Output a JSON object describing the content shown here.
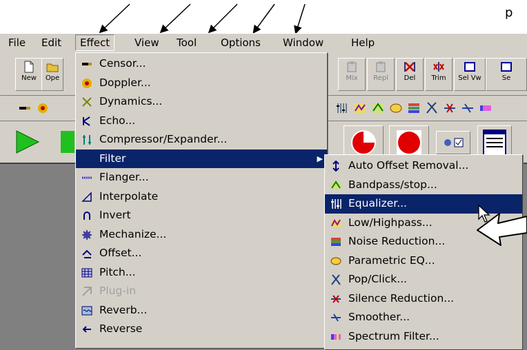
{
  "annotation": {
    "callout_text": "p"
  },
  "menubar": {
    "items": [
      "File",
      "Edit",
      "Effect",
      "View",
      "Tool",
      "Options",
      "Window",
      "Help"
    ]
  },
  "toolbar": {
    "left_buttons": [
      {
        "label": "New",
        "icon": "new-file-icon"
      },
      {
        "label": "Ope",
        "icon": "open-folder-icon"
      }
    ],
    "right_buttons": [
      {
        "label": "Mix",
        "icon": "mix-icon"
      },
      {
        "label": "Repl",
        "icon": "replace-icon"
      },
      {
        "label": "Del",
        "icon": "delete-icon"
      },
      {
        "label": "Trim",
        "icon": "trim-icon"
      },
      {
        "label": "Sel Vw",
        "icon": "select-view-icon"
      },
      {
        "label": "Se",
        "icon": "select-icon"
      }
    ]
  },
  "effect_menu": {
    "items": [
      {
        "label": "Censor...",
        "icon": "censor-icon"
      },
      {
        "label": "Doppler...",
        "icon": "doppler-icon"
      },
      {
        "label": "Dynamics...",
        "icon": "dynamics-icon"
      },
      {
        "label": "Echo...",
        "icon": "echo-icon"
      },
      {
        "label": "Compressor/Expander...",
        "icon": "compressor-icon"
      },
      {
        "label": "Filter",
        "icon": "",
        "submenu": "▶"
      },
      {
        "label": "Flanger...",
        "icon": "flanger-icon"
      },
      {
        "label": "Interpolate",
        "icon": "interpolate-icon"
      },
      {
        "label": "Invert",
        "icon": "invert-icon"
      },
      {
        "label": "Mechanize...",
        "icon": "mechanize-icon"
      },
      {
        "label": "Offset...",
        "icon": "offset-icon"
      },
      {
        "label": "Pitch...",
        "icon": "pitch-icon"
      },
      {
        "label": "Plug-in",
        "icon": "plugin-icon"
      },
      {
        "label": "Reverb...",
        "icon": "reverb-icon"
      },
      {
        "label": "Reverse",
        "icon": "reverse-icon"
      }
    ]
  },
  "filter_submenu": {
    "items": [
      {
        "label": "Auto Offset Removal...",
        "icon": "auto-offset-icon"
      },
      {
        "label": "Bandpass/stop...",
        "icon": "bandpass-icon"
      },
      {
        "label": "Equalizer...",
        "icon": "equalizer-icon"
      },
      {
        "label": "Low/Highpass...",
        "icon": "lowhighpass-icon"
      },
      {
        "label": "Noise Reduction...",
        "icon": "noise-reduction-icon"
      },
      {
        "label": "Parametric EQ...",
        "icon": "parametric-eq-icon"
      },
      {
        "label": "Pop/Click...",
        "icon": "pop-click-icon"
      },
      {
        "label": "Silence Reduction...",
        "icon": "silence-reduction-icon"
      },
      {
        "label": "Smoother...",
        "icon": "smoother-icon"
      },
      {
        "label": "Spectrum Filter...",
        "icon": "spectrum-filter-icon"
      }
    ]
  }
}
